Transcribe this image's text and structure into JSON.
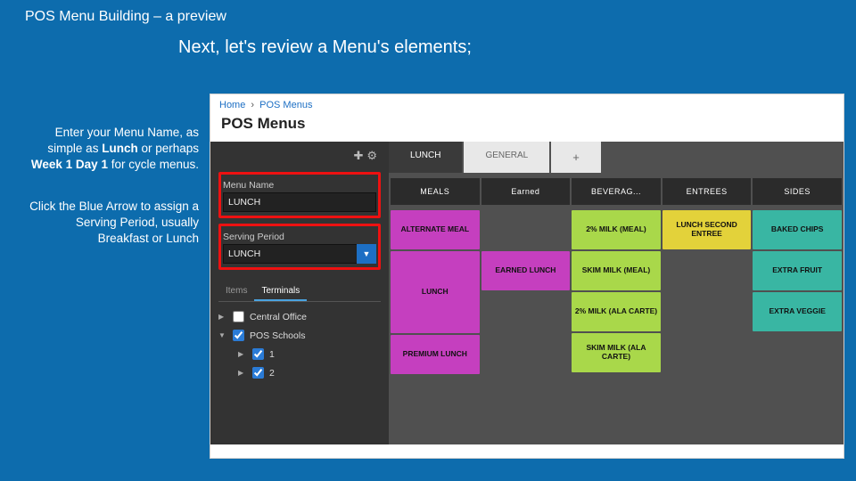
{
  "slide": {
    "title": "POS Menu Building – a preview",
    "headline": "Next, let's review a Menu's elements;",
    "note1_a": "Enter your Menu Name, as simple as ",
    "note1_b": "Lunch",
    "note1_c": " or perhaps ",
    "note1_d": "Week 1 Day 1",
    "note1_e": " for cycle menus.",
    "note2_a": "Click the Blue Arrow to assign a Serving Period, usually Breakfast or Lunch"
  },
  "app": {
    "crumb1": "Home",
    "crumb2": "POS Menus",
    "heading": "POS Menus",
    "menuNameLabel": "Menu Name",
    "menuNameValue": "LUNCH",
    "servingPeriodLabel": "Serving Period",
    "servingPeriodValue": "LUNCH",
    "tabItems": "Items",
    "tabTerminals": "Terminals",
    "locCentral": "Central Office",
    "locSchools": "POS Schools",
    "loc1": "1",
    "loc2": "2",
    "topTabLunch": "LUNCH",
    "topTabGeneral": "GENERAL",
    "topTabPlus": "+",
    "catMeals": "MEALS",
    "catEarned": "Earned",
    "catBeverages": "BEVERAG...",
    "catEntrees": "ENTREES",
    "catSides": "SIDES",
    "tiles": {
      "altMeal": "ALTERNATE MEAL",
      "lunch": "LUNCH",
      "earnedLunch": "EARNED LUNCH",
      "premium": "PREMIUM LUNCH",
      "milk2meal": "2% MILK (MEAL)",
      "skimMilkMeal": "SKIM MILK (MEAL)",
      "milk2ala": "2% MILK (ALA CARTE)",
      "skimMilkAla": "SKIM MILK (ALA CARTE)",
      "lunchSecond": "LUNCH SECOND ENTREE",
      "bakedChips": "BAKED CHIPS",
      "extraFruit": "EXTRA FRUIT",
      "extraVeggie": "EXTRA VEGGIE"
    }
  }
}
